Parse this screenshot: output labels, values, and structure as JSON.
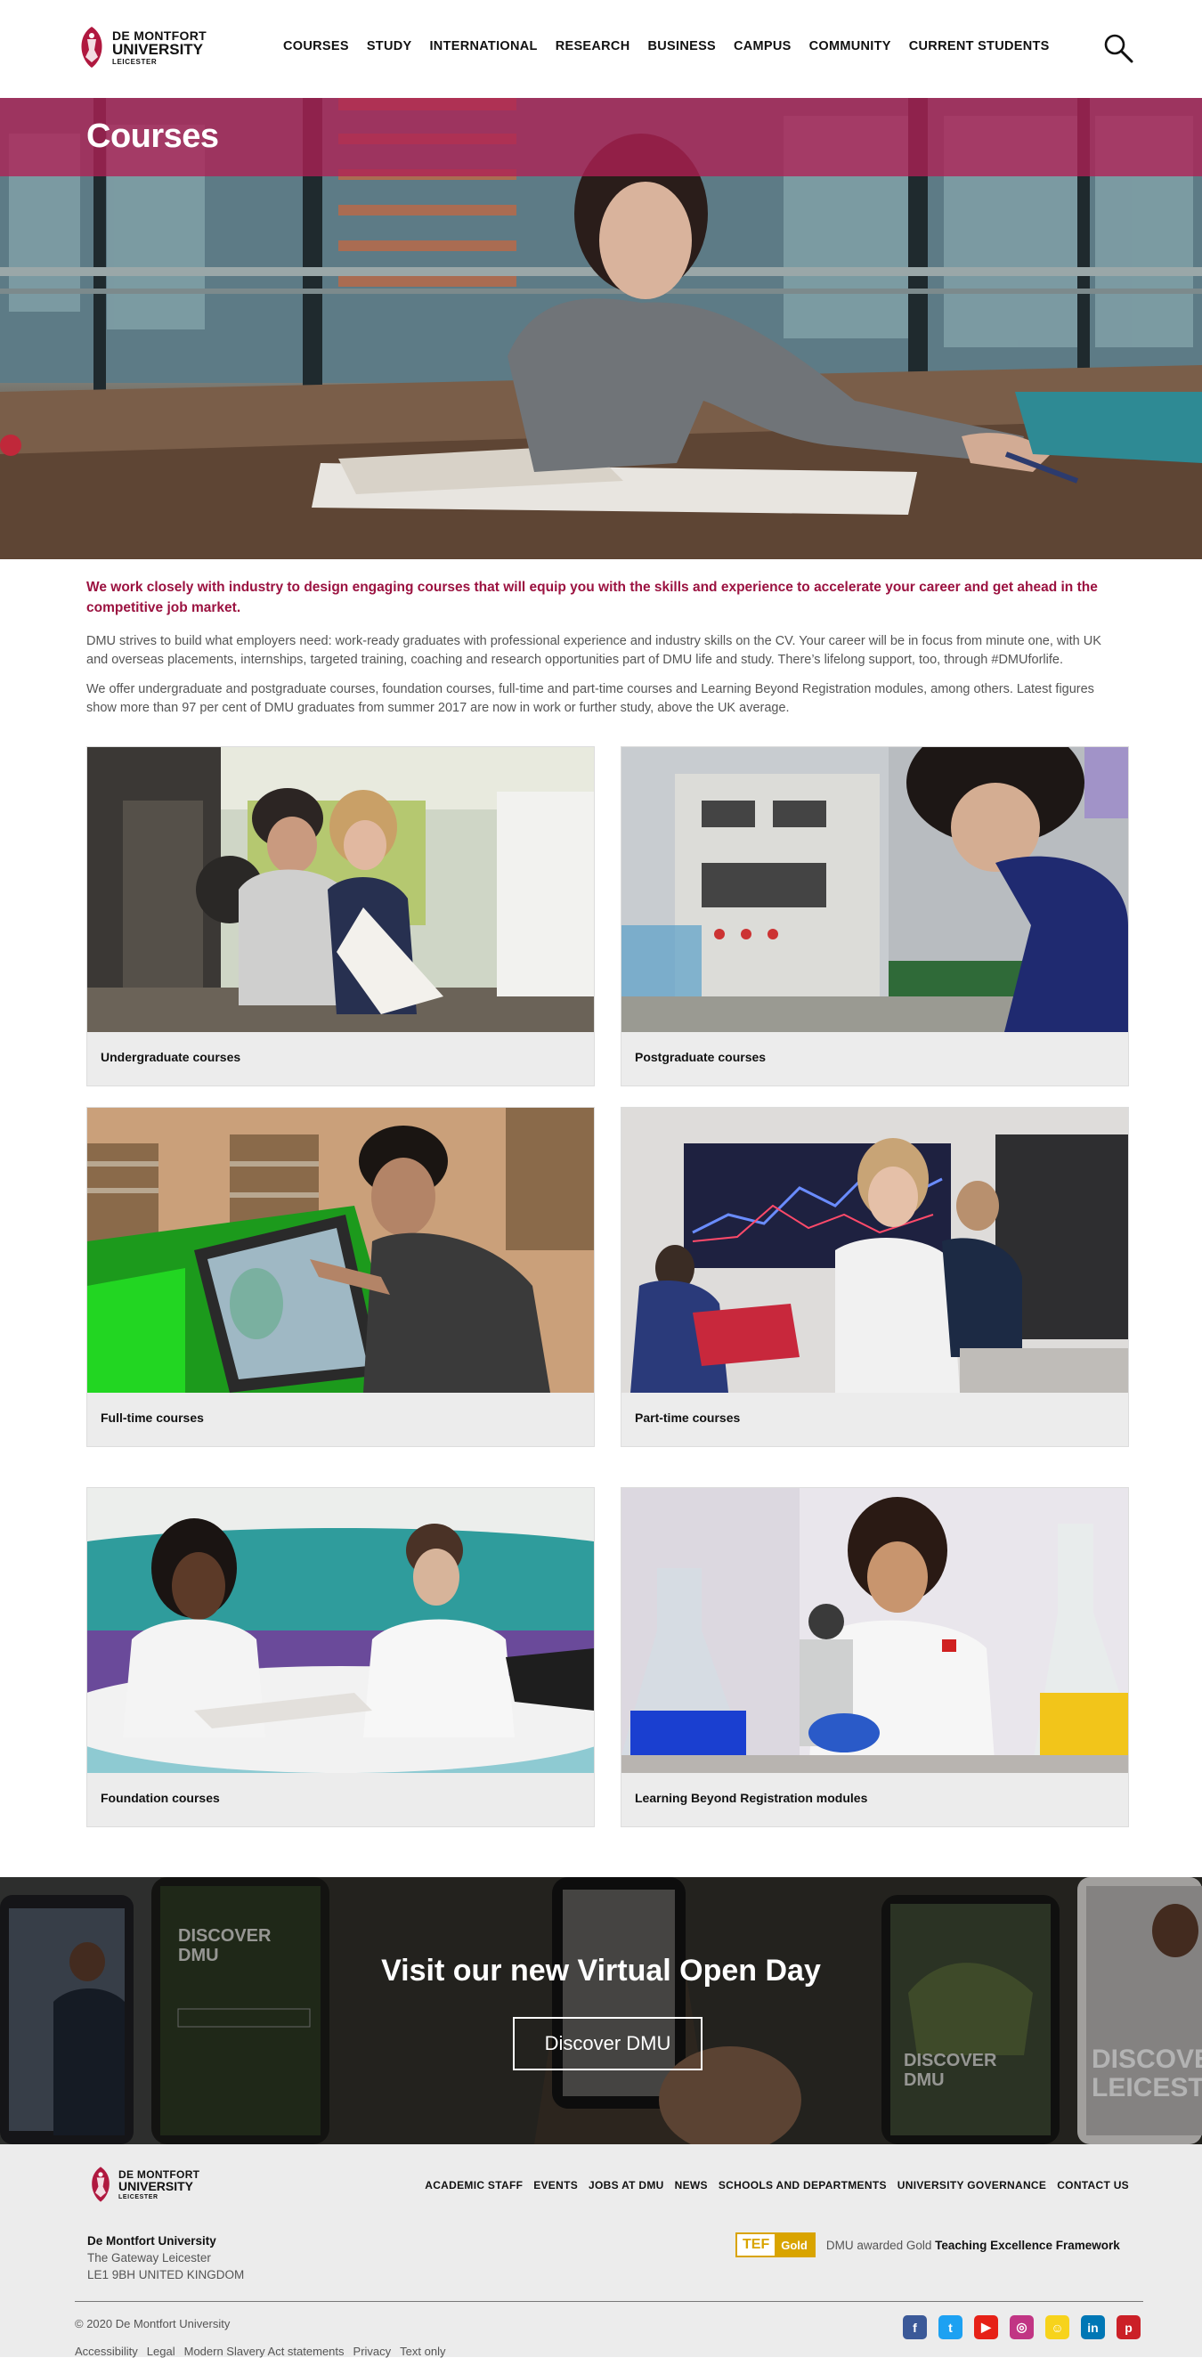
{
  "header": {
    "logo": {
      "line1": "DE MONTFORT",
      "line2": "UNIVERSITY",
      "line3": "LEICESTER"
    },
    "nav": [
      "COURSES",
      "STUDY",
      "INTERNATIONAL",
      "RESEARCH",
      "BUSINESS",
      "CAMPUS",
      "COMMUNITY",
      "CURRENT STUDENTS"
    ]
  },
  "hero": {
    "title": "Courses"
  },
  "intro": {
    "lead": "We work closely with industry to design engaging courses that will equip you with the skills and experience to accelerate your career and get ahead in the competitive job market.",
    "paragraphs": [
      "DMU strives to build what employers need: work-ready graduates with professional experience and industry skills on the CV. Your career will be in focus from minute one, with UK and overseas placements, internships, targeted training, coaching and research opportunities part of DMU life and study. There’s lifelong support, too, through #DMUforlife.",
      "We offer undergraduate and postgraduate courses, foundation courses, full-time and part-time courses and Learning Beyond Registration modules, among others. Latest figures show more than 97 per cent of DMU graduates from summer 2017 are now in work or further study, above the UK average."
    ]
  },
  "courses": [
    {
      "label": "Undergraduate courses"
    },
    {
      "label": "Postgraduate courses"
    },
    {
      "label": "Full-time courses"
    },
    {
      "label": "Part-time courses"
    },
    {
      "label": "Foundation courses"
    },
    {
      "label": "Learning Beyond Registration modules"
    }
  ],
  "virtual_open_day": {
    "title": "Visit our new Virtual Open Day",
    "button": "Discover DMU",
    "phone_texts": [
      "DISCOVER",
      "DMU",
      "DISCOVER",
      "DMU",
      "DISCOVE",
      "LEICESTE"
    ]
  },
  "footer": {
    "logo": {
      "line1": "DE MONTFORT",
      "line2": "UNIVERSITY",
      "line3": "LEICESTER"
    },
    "nav": [
      "ACADEMIC STAFF",
      "EVENTS",
      "JOBS AT DMU",
      "NEWS",
      "SCHOOLS AND DEPARTMENTS",
      "UNIVERSITY GOVERNANCE",
      "CONTACT US"
    ],
    "address": {
      "name": "De Montfort University",
      "line1": "The Gateway  Leicester",
      "line2": "LE1 9BH  UNITED KINGDOM"
    },
    "tef": {
      "badge_left": "TEF",
      "badge_right": "Gold",
      "text_plain": "DMU awarded Gold",
      "text_bold": "Teaching Excellence Framework"
    },
    "copyright": "© 2020 De Montfort University",
    "links": [
      "Accessibility",
      "Legal",
      "Modern Slavery Act statements",
      "Privacy",
      "Text only"
    ],
    "social": [
      {
        "icon": "facebook-icon",
        "glyph": "f",
        "color": "#3b5998"
      },
      {
        "icon": "twitter-icon",
        "glyph": "t",
        "color": "#1da1f2"
      },
      {
        "icon": "youtube-icon",
        "glyph": "▶",
        "color": "#e62117"
      },
      {
        "icon": "instagram-icon",
        "glyph": "◎",
        "color": "#c13584"
      },
      {
        "icon": "snapchat-icon",
        "glyph": "☺",
        "color": "#f7d31c"
      },
      {
        "icon": "linkedin-icon",
        "glyph": "in",
        "color": "#0077b5"
      },
      {
        "icon": "pinterest-icon",
        "glyph": "p",
        "color": "#cb2027"
      }
    ]
  }
}
